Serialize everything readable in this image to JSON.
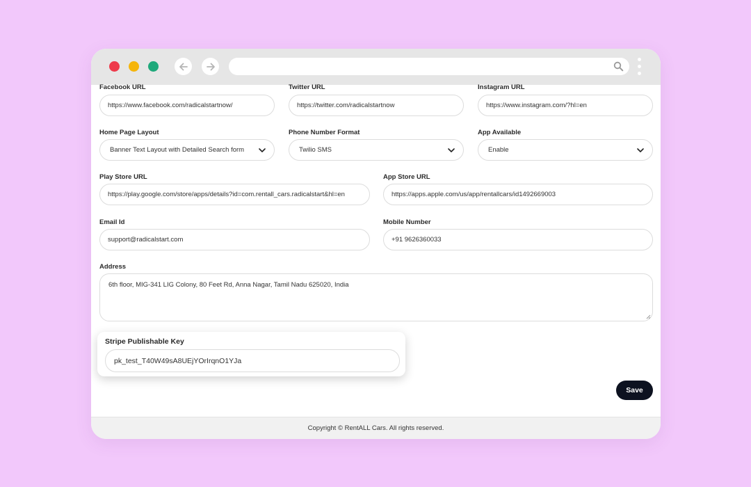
{
  "colors": {
    "background": "#f2c8fb",
    "close_dot": "#ee3a4b",
    "minimize_dot": "#f5b50c",
    "maximize_dot": "#1fa97b",
    "save_button": "#0d1220"
  },
  "browser": {
    "back_icon": "arrow-left-icon",
    "forward_icon": "arrow-right-icon",
    "search_icon": "search-icon",
    "menu_icon": "kebab-menu-icon",
    "url": ""
  },
  "form": {
    "facebook": {
      "label": "Facebook URL",
      "value": "https://www.facebook.com/radicalstartnow/"
    },
    "twitter": {
      "label": "Twitter URL",
      "value": "https://twitter.com/radicalstartnow"
    },
    "instagram": {
      "label": "Instagram URL",
      "value": "https://www.instagram.com/?hl=en"
    },
    "home_layout": {
      "label": "Home Page Layout",
      "value": "Banner Text Layout with Detailed Search form"
    },
    "phone_format": {
      "label": "Phone Number Format",
      "value": "Twilio SMS"
    },
    "app_available": {
      "label": "App Available",
      "value": "Enable"
    },
    "play_store": {
      "label": "Play Store URL",
      "value": "https://play.google.com/store/apps/details?id=com.rentall_cars.radicalstart&hl=en"
    },
    "app_store": {
      "label": "App Store URL",
      "value": "https://apps.apple.com/us/app/rentallcars/id1492669003"
    },
    "email": {
      "label": "Email Id",
      "value": "support@radicalstart.com"
    },
    "mobile": {
      "label": "Mobile Number",
      "value": "+91 9626360033"
    },
    "address": {
      "label": "Address",
      "value": "6th floor, MIG-341 LIG Colony, 80 Feet Rd, Anna Nagar, Tamil Nadu 625020, India"
    },
    "stripe_key": {
      "label": "Stripe Publishable Key",
      "value": "pk_test_T40W49sA8UEjYOrIrqnO1YJa"
    },
    "save_label": "Save"
  },
  "footer": {
    "copyright": "Copyright © RentALL Cars. All rights reserved."
  }
}
